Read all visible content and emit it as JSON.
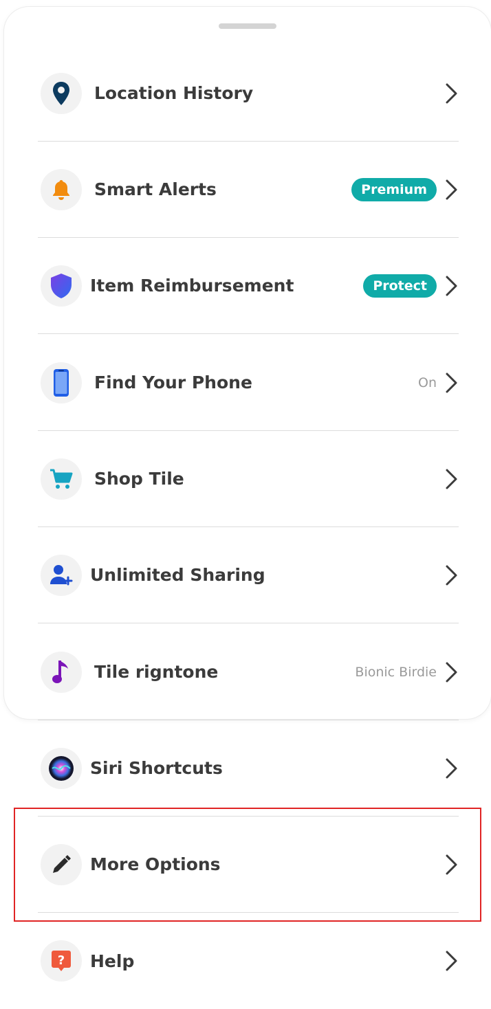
{
  "menu": {
    "items": [
      {
        "label": "Location History",
        "icon": "location-pin-icon"
      },
      {
        "label": "Smart Alerts",
        "badge": "Premium",
        "icon": "bell-icon"
      },
      {
        "label": "Item Reimbursement",
        "badge": "Protect",
        "icon": "shield-icon"
      },
      {
        "label": "Find Your Phone",
        "value": "On",
        "icon": "phone-icon"
      },
      {
        "label": "Shop Tile",
        "icon": "cart-icon"
      },
      {
        "label": "Unlimited Sharing",
        "icon": "add-user-icon"
      },
      {
        "label": "Tile rigntone",
        "value": "Bionic Birdie",
        "icon": "music-note-icon"
      },
      {
        "label": "Siri Shortcuts",
        "icon": "siri-icon"
      },
      {
        "label": "More Options",
        "icon": "pencil-icon"
      },
      {
        "label": "Help",
        "icon": "help-icon"
      }
    ]
  },
  "colors": {
    "accent": "#10aba8",
    "text": "#3b3b3b",
    "muted": "#9a9a9a",
    "highlight": "#e02424"
  }
}
